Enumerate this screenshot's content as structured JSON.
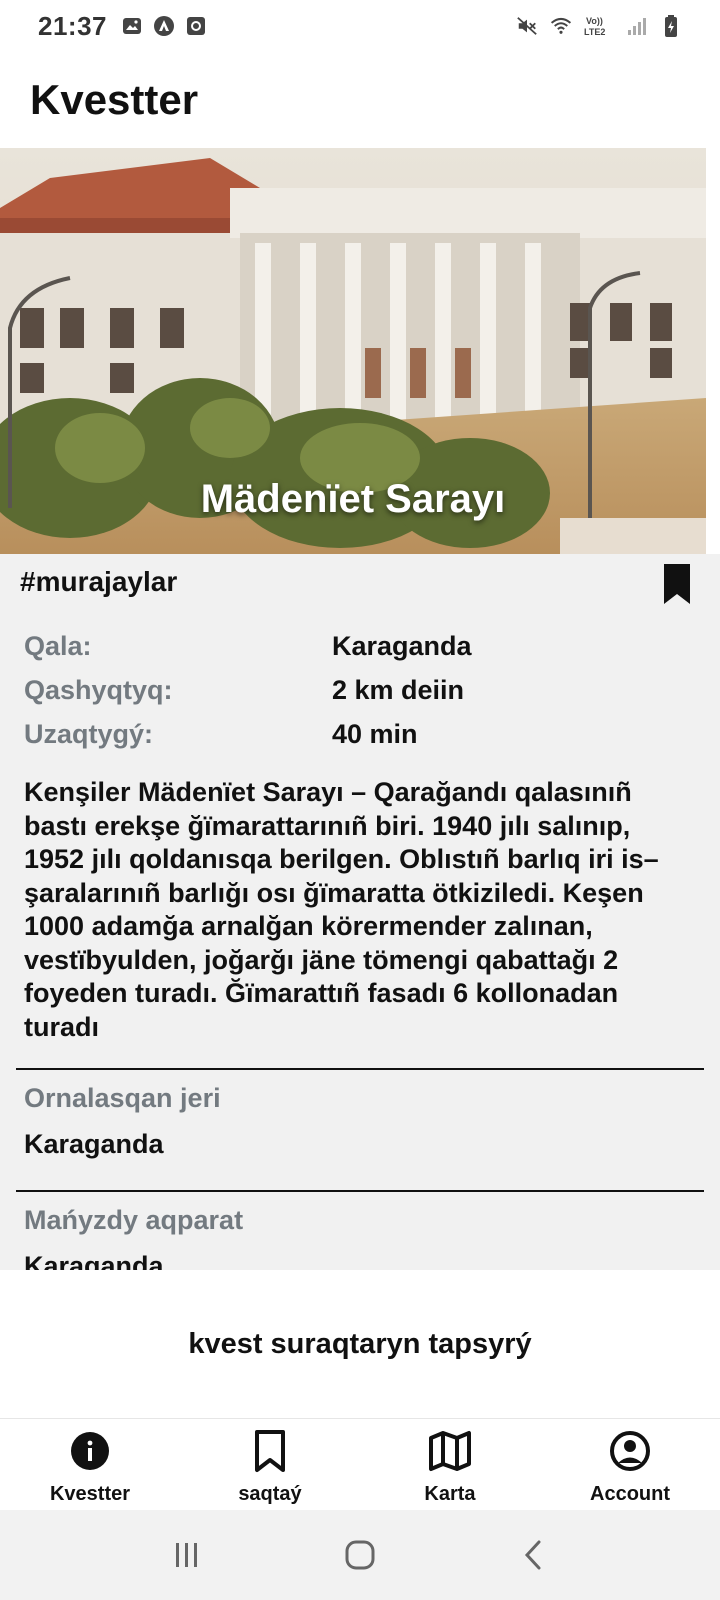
{
  "status_bar": {
    "time": "21:37"
  },
  "app_bar": {
    "title": "Kvestter"
  },
  "hero": {
    "title": "Mädenïet Sarayı"
  },
  "quest": {
    "tag": "#murajaylar",
    "info": [
      {
        "label": "Qala:",
        "value": "Karaganda"
      },
      {
        "label": "Qashyqtyq:",
        "value": "2 km deiin"
      },
      {
        "label": "Uzaqtygý:",
        "value": "40 min"
      }
    ],
    "description": "Kenşiler Mädenïet Sarayı – Qarağandı qalasınıñ bastı erekşe ğïmarattarınıñ biri. 1940 jılı salınıp, 1952 jılı qoldanısqa berilgen. Oblıstıñ barlıq iri is–şaralarınıñ barlığı osı ğïmaratta ötkiziledi. Keşen 1000 adamğa arnalğan körermender zalınan, vestïbyulden, joğarğı jäne tömengi qabattağı 2 foyeden turadı. Ğïmarattıñ fasadı 6 kollonadan turadı",
    "location_title": "Ornalasqan jeri",
    "location_value": "Karaganda",
    "important_title": "Mańyzdy aqparat",
    "important_value": "Karaganda"
  },
  "action": {
    "label": "kvest suraqtaryn tapsyrý"
  },
  "bottom_nav": [
    {
      "label": "Kvestter",
      "icon": "info-icon"
    },
    {
      "label": "saqtaý",
      "icon": "bookmark-icon"
    },
    {
      "label": "Karta",
      "icon": "map-icon"
    },
    {
      "label": "Account",
      "icon": "account-icon"
    }
  ]
}
